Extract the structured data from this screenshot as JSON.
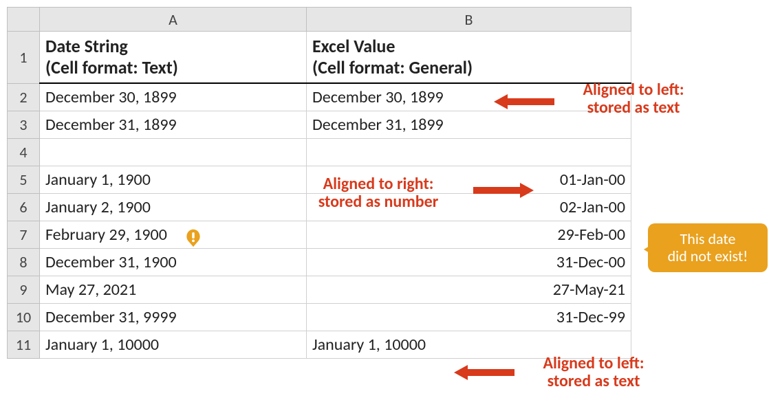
{
  "columns": {
    "A": "A",
    "B": "B"
  },
  "rows": [
    "1",
    "2",
    "3",
    "4",
    "5",
    "6",
    "7",
    "8",
    "9",
    "10",
    "11"
  ],
  "header": {
    "A_line1": "Date String",
    "A_line2": "(Cell format: Text)",
    "B_line1": "Excel Value",
    "B_line2": "(Cell format: General)"
  },
  "cells": {
    "r2": {
      "A": "December 30, 1899",
      "B": "December 30, 1899",
      "B_align": "left"
    },
    "r3": {
      "A": "December 31, 1899",
      "B": "December 31, 1899",
      "B_align": "left"
    },
    "r4": {
      "A": "",
      "B": "",
      "B_align": "left"
    },
    "r5": {
      "A": "January 1, 1900",
      "B": "01-Jan-00",
      "B_align": "right"
    },
    "r6": {
      "A": "January 2, 1900",
      "B": "02-Jan-00",
      "B_align": "right"
    },
    "r7": {
      "A": "February 29, 1900",
      "B": "29-Feb-00",
      "B_align": "right"
    },
    "r8": {
      "A": "December 31, 1900",
      "B": "31-Dec-00",
      "B_align": "right"
    },
    "r9": {
      "A": "May 27, 2021",
      "B": "27-May-21",
      "B_align": "right"
    },
    "r10": {
      "A": "December 31, 9999",
      "B": "31-Dec-99",
      "B_align": "right"
    },
    "r11": {
      "A": "January 1, 10000",
      "B": "January 1, 10000",
      "B_align": "left"
    }
  },
  "annotations": {
    "topRight_line1": "Aligned to left:",
    "topRight_line2": "stored as text",
    "midLeft_line1": "Aligned to right:",
    "midLeft_line2": "stored as number",
    "callout_line1": "This date",
    "callout_line2": "did not exist!",
    "bottom_line1": "Aligned to left:",
    "bottom_line2": "stored as text"
  },
  "colors": {
    "headerBg": "#e6e6e6",
    "gridBorder": "#d0d0d0",
    "annotRed": "#d83a1c",
    "calloutBg": "#e9a11e"
  },
  "colWidths": {
    "rowHeader": 38,
    "A": 388,
    "B": 472
  }
}
